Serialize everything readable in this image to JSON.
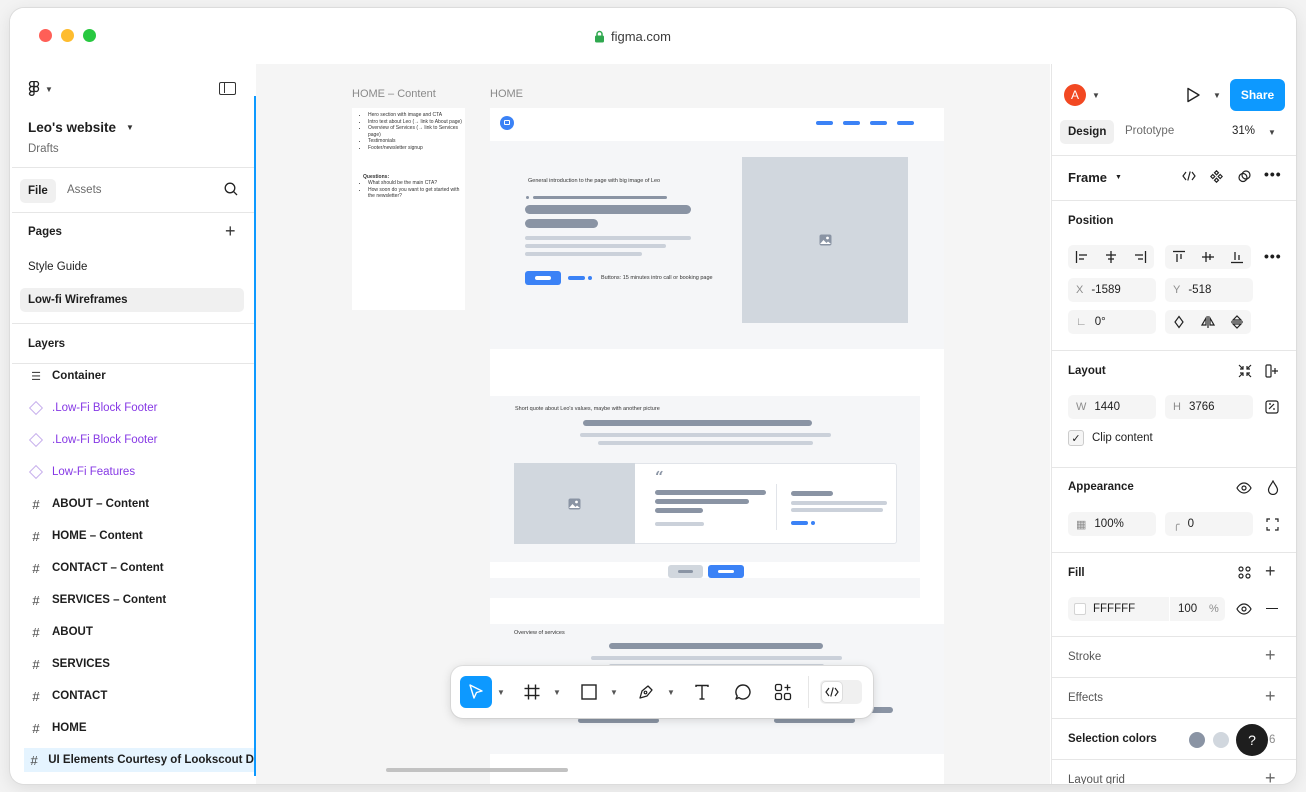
{
  "browser": {
    "url": "figma.com"
  },
  "file": {
    "name": "Leo's website",
    "location": "Drafts"
  },
  "left_tabs": {
    "file": "File",
    "assets": "Assets"
  },
  "pages": {
    "title": "Pages",
    "items": [
      "Style Guide",
      "Low-fi Wireframes"
    ],
    "selected": "Low-fi Wireframes"
  },
  "layers": {
    "title": "Layers",
    "items": [
      {
        "label": "Container",
        "kind": "container"
      },
      {
        "label": ".Low-Fi Block Footer",
        "kind": "component"
      },
      {
        "label": ".Low-Fi Block Footer",
        "kind": "component"
      },
      {
        "label": "Low-Fi Features",
        "kind": "component"
      },
      {
        "label": "ABOUT – Content",
        "kind": "frame"
      },
      {
        "label": "HOME – Content",
        "kind": "frame"
      },
      {
        "label": "CONTACT – Content",
        "kind": "frame"
      },
      {
        "label": "SERVICES – Content",
        "kind": "frame"
      },
      {
        "label": "ABOUT",
        "kind": "frame"
      },
      {
        "label": "SERVICES",
        "kind": "frame"
      },
      {
        "label": "CONTACT",
        "kind": "frame"
      },
      {
        "label": "HOME",
        "kind": "frame"
      },
      {
        "label": "UI Elements Courtesy of Lookscout D",
        "kind": "frame"
      }
    ]
  },
  "canvas": {
    "frame_labels": {
      "content": "HOME – Content",
      "home": "HOME"
    },
    "notes": {
      "bullets": [
        "Hero section with image and CTA",
        "Intro text about Leo (→ link to About page)",
        "Overview of Services (→ link to Services page)",
        "Testimonials",
        "Footer/newsletter signup"
      ],
      "questions_title": "Questions:",
      "questions": [
        "What should be the main CTA?",
        "How soon do you want to get started with the newsletter?"
      ]
    },
    "hero_caption": "General introduction to the page with big image of Leo",
    "buttons_caption": "Buttons: 15 minutes intro call or booking page",
    "quote_caption": "Short quote about Leo's values, maybe with another picture",
    "services_caption": "Overview of services"
  },
  "right": {
    "avatar_initial": "A",
    "share_label": "Share",
    "tabs": {
      "design": "Design",
      "prototype": "Prototype"
    },
    "zoom": "31%",
    "frame_label": "Frame",
    "position": {
      "title": "Position",
      "x_label": "X",
      "x": "-1589",
      "y_label": "Y",
      "y": "-518",
      "rotation": "0°"
    },
    "layout": {
      "title": "Layout",
      "w_label": "W",
      "w": "1440",
      "h_label": "H",
      "h": "3766",
      "clip_label": "Clip content"
    },
    "appearance": {
      "title": "Appearance",
      "opacity": "100%",
      "radius": "0"
    },
    "fill": {
      "title": "Fill",
      "hex": "FFFFFF",
      "opacity": "100",
      "unit": "%"
    },
    "stroke": {
      "title": "Stroke"
    },
    "effects": {
      "title": "Effects"
    },
    "selection_colors": {
      "title": "Selection colors",
      "count": "6"
    },
    "layout_grid": {
      "title": "Layout grid"
    },
    "help": "?"
  },
  "colors": {
    "accent": "#0d99ff",
    "share": "#0d99ff",
    "avatar": "#f24822",
    "component": "#8638e5",
    "wire_blue": "#3b82f6"
  }
}
